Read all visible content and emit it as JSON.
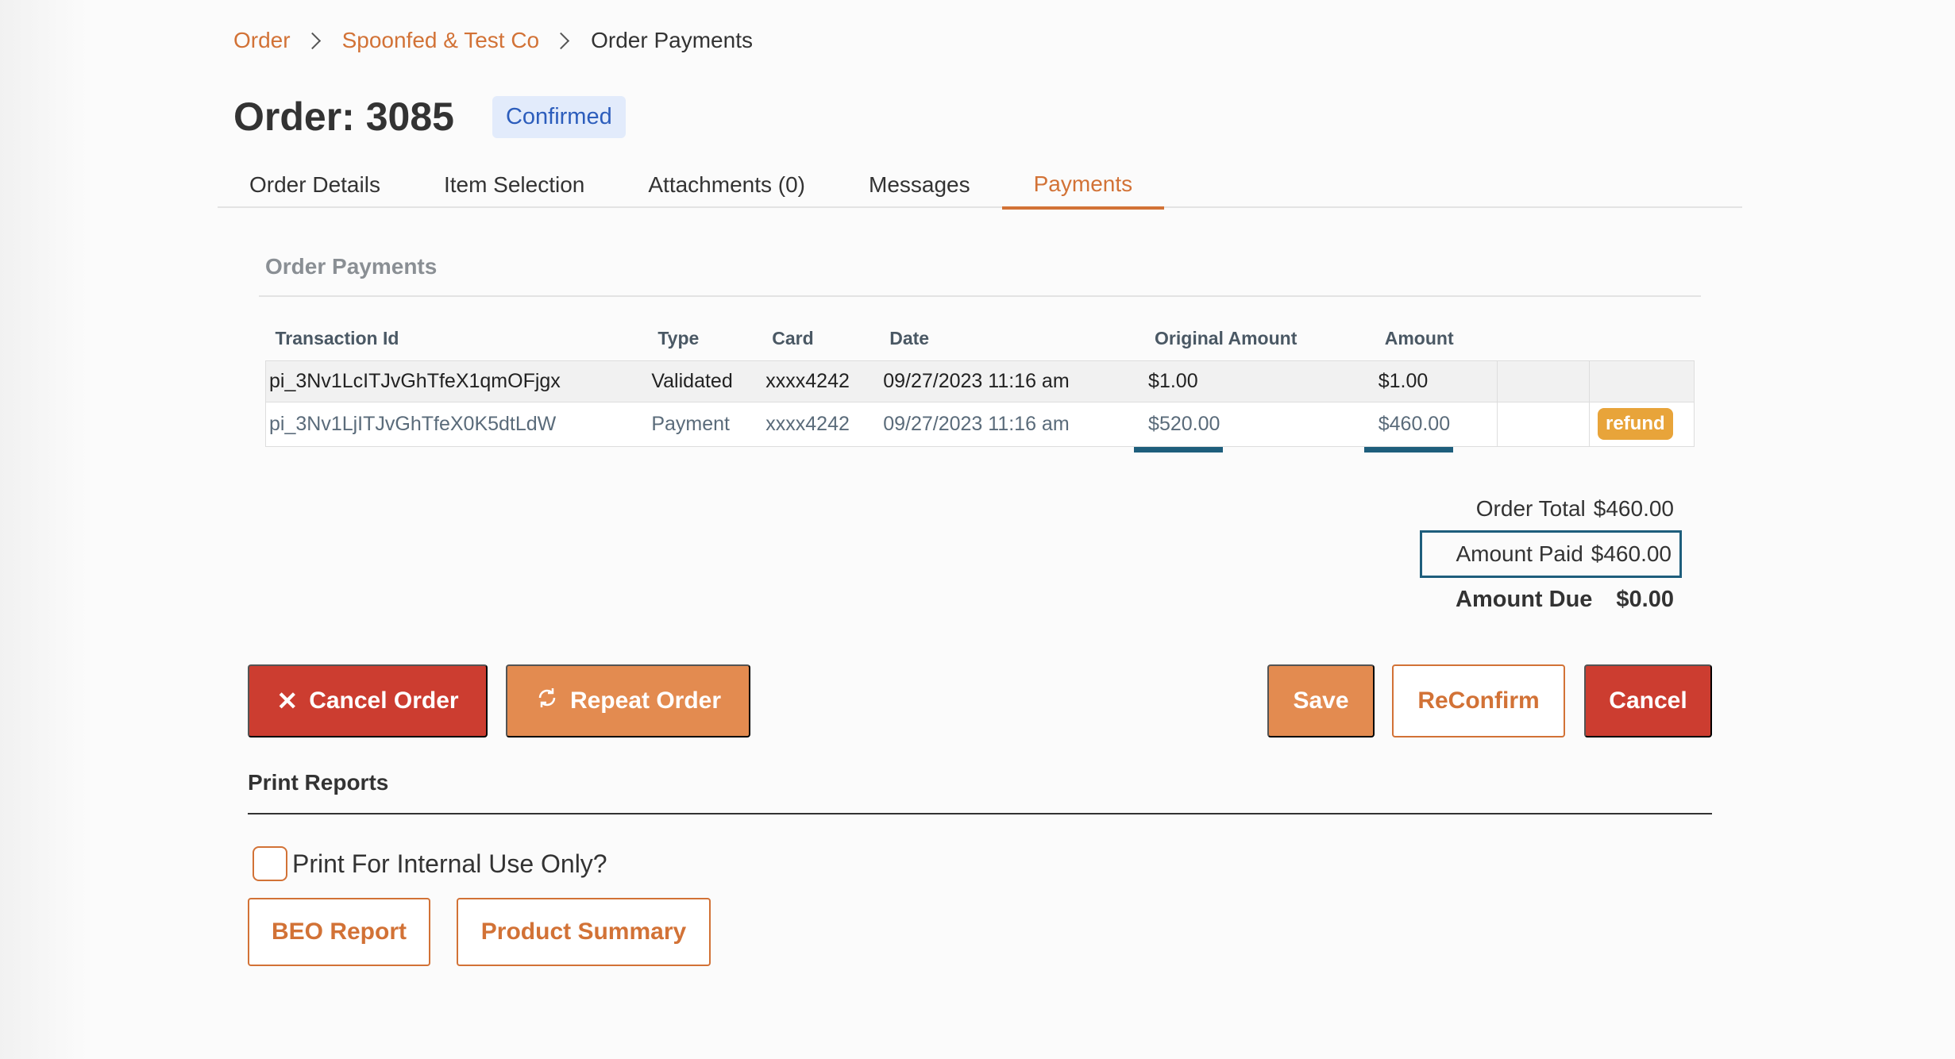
{
  "breadcrumb": {
    "items": [
      {
        "label": "Order"
      },
      {
        "label": "Spoonfed & Test Co"
      },
      {
        "label": "Order Payments"
      }
    ]
  },
  "order": {
    "title": "Order: 3085",
    "status": "Confirmed"
  },
  "tabs": [
    {
      "label": "Order Details",
      "active": false
    },
    {
      "label": "Item Selection",
      "active": false
    },
    {
      "label": "Attachments (0)",
      "active": false
    },
    {
      "label": "Messages",
      "active": false
    },
    {
      "label": "Payments",
      "active": true
    }
  ],
  "payments": {
    "section_title": "Order Payments",
    "columns": [
      "Transaction Id",
      "Type",
      "Card",
      "Date",
      "Original Amount",
      "Amount"
    ],
    "rows": [
      {
        "transaction_id": "pi_3Nv1LcITJvGhTfeX1qmOFjgx",
        "type": "Validated",
        "card": "xxxx4242",
        "date": "09/27/2023 11:16 am",
        "original_amount": "$1.00",
        "amount": "$1.00"
      },
      {
        "transaction_id": "pi_3Nv1LjITJvGhTfeX0K5dtLdW",
        "type": "Payment",
        "card": "xxxx4242",
        "date": "09/27/2023 11:16 am",
        "original_amount": "$520.00",
        "amount": "$460.00",
        "action": "refund"
      }
    ]
  },
  "totals": {
    "order_total_label": "Order Total",
    "order_total": "$460.00",
    "amount_paid_label": "Amount Paid",
    "amount_paid": "$460.00",
    "amount_due_label": "Amount Due",
    "amount_due": "$0.00"
  },
  "actions": {
    "cancel_order": "Cancel Order",
    "repeat_order": "Repeat Order",
    "save": "Save",
    "reconfirm": "ReConfirm",
    "cancel": "Cancel"
  },
  "print_reports": {
    "title": "Print Reports",
    "internal_label": "Print For Internal Use Only?",
    "internal_checked": false,
    "beo_report": "BEO Report",
    "product_summary": "Product Summary"
  },
  "colors": {
    "accent": "#d27236",
    "danger": "#cc3d30",
    "highlight_border": "#1e5e7c",
    "badge_bg": "#e2ebfb",
    "badge_text": "#2c5dbc"
  },
  "icons": {
    "cancel_order": "close-icon",
    "repeat_order": "refresh-icon",
    "breadcrumb_separator": "chevron-right-icon"
  }
}
